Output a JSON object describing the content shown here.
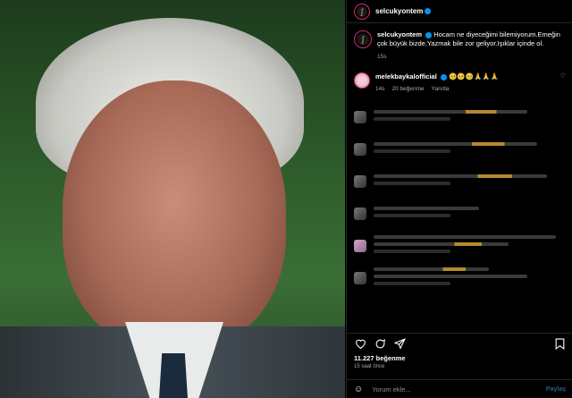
{
  "post": {
    "author": "selcukyontem",
    "caption": "Hocam ne diyeceğimi bilemiyorum.Emeğin çok büyük bizde.Yazmak bile zor geliyor.Işıklar içinde ol.",
    "caption_time": "15s"
  },
  "comment": {
    "author": "melekbaykalofficial",
    "text": "🥺🥺🥺🙏🙏🙏",
    "time": "14s",
    "likes": "20 beğenme",
    "reply": "Yanıtla"
  },
  "likes_count": "11.227 beğenme",
  "time_ago": "15 saat önce",
  "comment_input": {
    "placeholder": "Yorum ekle...",
    "post_label": "Paylaş"
  },
  "icons": {
    "like": "heart-icon",
    "comment": "comment-icon",
    "share": "share-icon",
    "save": "bookmark-icon",
    "emoji": "emoji-icon"
  },
  "colors": {
    "accent": "#0095f6",
    "ring": "#d62976"
  }
}
